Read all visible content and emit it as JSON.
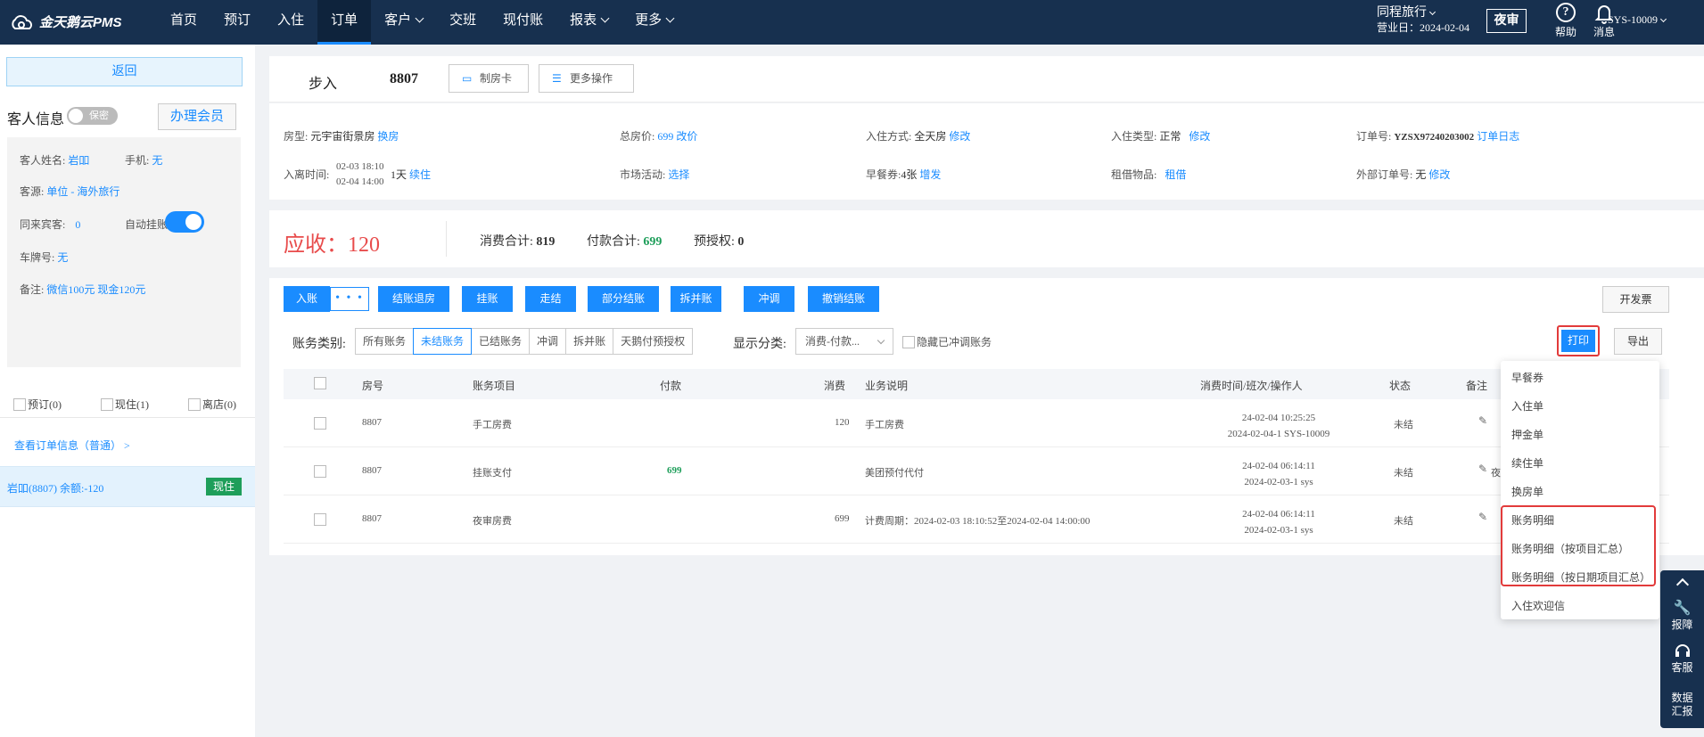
{
  "brand": "金天鹅云PMS",
  "nav": [
    "首页",
    "预订",
    "入住",
    "订单",
    "客户",
    "交班",
    "现付账",
    "报表",
    "更多"
  ],
  "hotel_name": "同程旅行",
  "business_date": "营业日：2024-02-04",
  "night_audit": "夜审",
  "help": "帮助",
  "messages": "消息",
  "user": "SYS-10009",
  "sidebar": {
    "back": "返回",
    "guest_info": "客人信息",
    "privacy": "保密",
    "member": "办理会员",
    "name_label": "客人姓名:",
    "name": "岩吅",
    "phone_label": "手机:",
    "phone": "无",
    "source_label": "客源:",
    "source": "单位  - 海外旅行",
    "companions_label": "同来宾客:",
    "companions": "0",
    "auto_hang_label": "自动挂账:",
    "plate_label": "车牌号:",
    "plate": "无",
    "remark_label": "备注:",
    "remark": "微信100元 现金120元",
    "booked": "预订(0)",
    "staying": "现住(1)",
    "left": "离店(0)",
    "view_order": "查看订单信息（普通） >",
    "room_entry": "岩吅(8807)   余额:-120",
    "room_badge": "现住"
  },
  "header": {
    "status": "步入",
    "room": "8807",
    "make_card": "制房卡",
    "more_ops": "更多操作"
  },
  "info": {
    "room_type_label": "房型:",
    "room_type": "元宇宙街景房",
    "change_room": "换房",
    "total_label": "总房价:",
    "total": "699",
    "change_price": "改价",
    "checkin_mode_label": "入住方式:",
    "checkin_mode": "全天房",
    "modify": "修改",
    "checkin_type_label": "入住类型:",
    "checkin_type": "正常",
    "order_no_label": "订单号:",
    "order_no": "YZSX97240203002",
    "order_log": "订单日志",
    "stay_label": "入离时间:",
    "arrive": "02-03 18:10",
    "depart": "02-04 14:00",
    "nights": "1天",
    "extend": "续住",
    "promo_label": "市场活动:",
    "promo": "选择",
    "breakfast_label": "早餐券:",
    "breakfast": "4张",
    "add_issue": "增发",
    "rental_label": "租借物品:",
    "rental": "租借",
    "ext_order_label": "外部订单号:",
    "ext_order": "无"
  },
  "summary": {
    "due": "应收：120",
    "consume_label": "消费合计:",
    "consume": "819",
    "pay_label": "付款合计:",
    "pay": "699",
    "preauth_label": "预授权:",
    "preauth": "0"
  },
  "actions": {
    "post": "入账",
    "more": "• • •",
    "buttons": [
      "结账退房",
      "挂账",
      "走结",
      "部分结账",
      "拆并账",
      "冲调",
      "撤销结账"
    ],
    "invoice": "开发票",
    "category_label": "账务类别:",
    "tabs": [
      "所有账务",
      "未结账务",
      "已结账务",
      "冲调",
      "拆并账",
      "天鹅付预授权"
    ],
    "display_label": "显示分类:",
    "display_value": "消费-付款...",
    "hide_reversed": "隐藏已冲调账务",
    "print": "打印",
    "export": "导出"
  },
  "table": {
    "headers": [
      "房号",
      "账务项目",
      "付款",
      "消费",
      "业务说明",
      "消费时间/班次/操作人",
      "状态",
      "备注"
    ],
    "rows": [
      {
        "room": "8807",
        "item": "手工房费",
        "pay": "",
        "consume": "120",
        "desc": "手工房费",
        "time": "24-02-04 10:25:25",
        "shift": "2024-02-04-1 SYS-10009",
        "status": "未结",
        "remark": ""
      },
      {
        "room": "8807",
        "item": "挂账支付",
        "pay": "699",
        "consume": "",
        "desc": "美团预付代付",
        "time": "24-02-04 06:14:11",
        "shift": "2024-02-03-1 sys",
        "status": "未结",
        "remark": "夜"
      },
      {
        "room": "8807",
        "item": "夜审房费",
        "pay": "",
        "consume": "699",
        "desc": "计费周期：2024-02-03 18:10:52至2024-02-04 14:00:00",
        "time": "24-02-04 06:14:11",
        "shift": "2024-02-03-1 sys",
        "status": "未结",
        "remark": ""
      }
    ]
  },
  "print_menu": [
    "早餐券",
    "入住单",
    "押金单",
    "续住单",
    "换房单",
    "账务明细",
    "账务明细（按项目汇总）",
    "账务明细（按日期项目汇总）",
    "入住欢迎信"
  ],
  "float": {
    "report": "报障",
    "service": "客服",
    "data1": "数据",
    "data2": "汇报"
  }
}
